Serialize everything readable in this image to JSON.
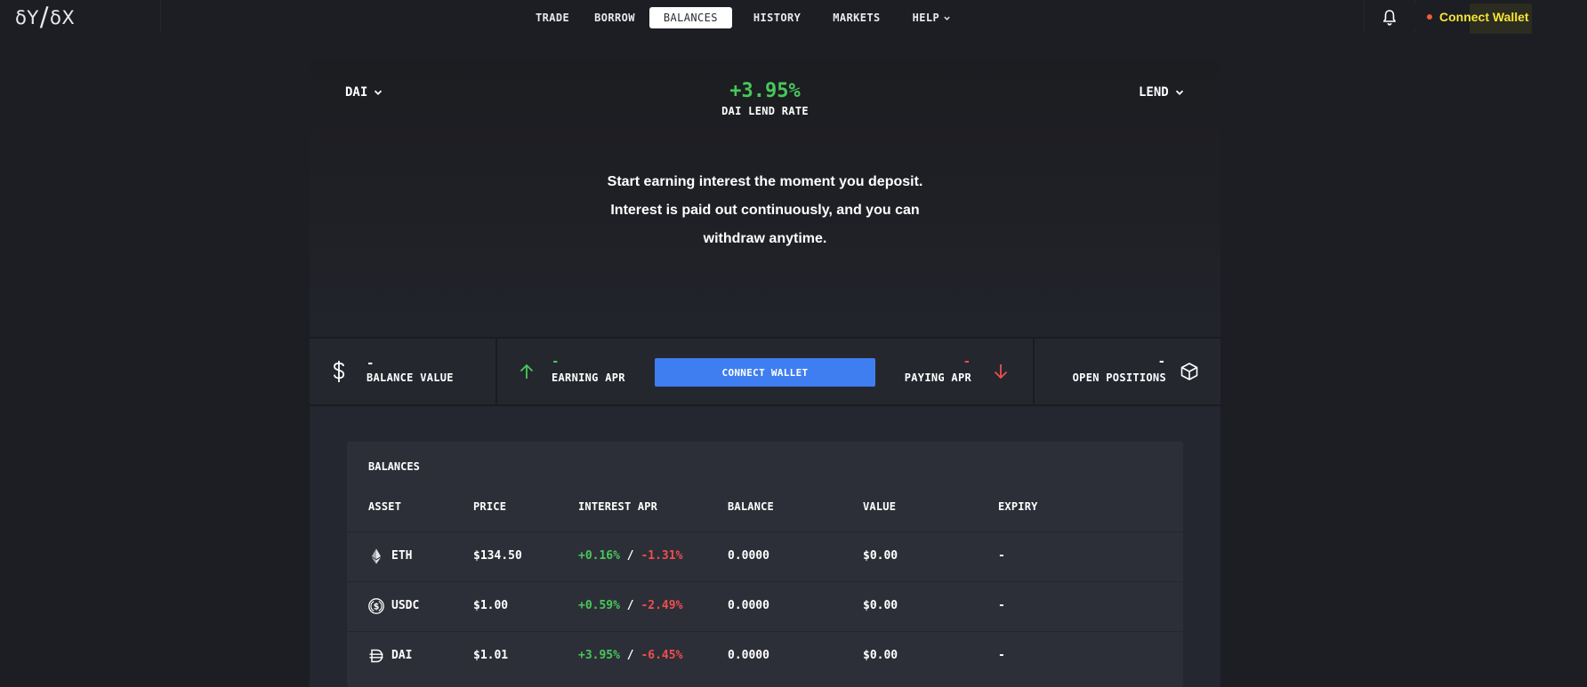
{
  "header": {
    "logo": {
      "numerator": "δY",
      "denominator": "δX"
    },
    "nav": [
      {
        "label": "TRADE",
        "active": false
      },
      {
        "label": "BORROW",
        "active": false
      },
      {
        "label": "BALANCES",
        "active": true
      },
      {
        "label": "HISTORY",
        "active": false
      },
      {
        "label": "MARKETS",
        "active": false
      },
      {
        "label": "HELP",
        "active": false,
        "has_dropdown": true
      }
    ],
    "notifications_icon": "bell-icon",
    "connect_wallet_label": "Connect Wallet",
    "connect_wallet_color": "#f5e536"
  },
  "hero": {
    "asset_selector": "DAI",
    "mode_selector": "LEND",
    "rate_value": "+3.95%",
    "rate_label": "DAI LEND RATE",
    "description_lines": [
      "Start earning interest the moment you deposit.",
      "Interest is paid out continuously, and you can",
      "withdraw anytime."
    ]
  },
  "stats": {
    "balance_value": {
      "value": "-",
      "label": "BALANCE VALUE",
      "icon": "dollar-icon"
    },
    "earning_apr": {
      "value": "-",
      "label": "EARNING APR",
      "icon": "arrow-up-icon"
    },
    "connect_button": "CONNECT WALLET",
    "paying_apr": {
      "value": "-",
      "label": "PAYING APR",
      "icon": "arrow-down-icon"
    },
    "open_positions": {
      "value": "-",
      "label": "OPEN POSITIONS",
      "icon": "cube-icon"
    }
  },
  "balances": {
    "title": "BALANCES",
    "columns": [
      "ASSET",
      "PRICE",
      "INTEREST APR",
      "BALANCE",
      "VALUE",
      "EXPIRY"
    ],
    "rows": [
      {
        "asset": "ETH",
        "icon": "eth-icon",
        "price": "$134.50",
        "apr_lend": "+0.16%",
        "separator": "/",
        "apr_borrow": "-1.31%",
        "balance": "0.0000",
        "value": "$0.00",
        "expiry": "-"
      },
      {
        "asset": "USDC",
        "icon": "usdc-icon",
        "price": "$1.00",
        "apr_lend": "+0.59%",
        "separator": "/",
        "apr_borrow": "-2.49%",
        "balance": "0.0000",
        "value": "$0.00",
        "expiry": "-"
      },
      {
        "asset": "DAI",
        "icon": "dai-icon",
        "price": "$1.01",
        "apr_lend": "+3.95%",
        "separator": "/",
        "apr_borrow": "-6.45%",
        "balance": "0.0000",
        "value": "$0.00",
        "expiry": "-"
      }
    ]
  },
  "colors": {
    "positive": "#47c85a",
    "negative": "#f04e4e",
    "accent": "#3f7ef0",
    "background": "#1c1e23"
  }
}
